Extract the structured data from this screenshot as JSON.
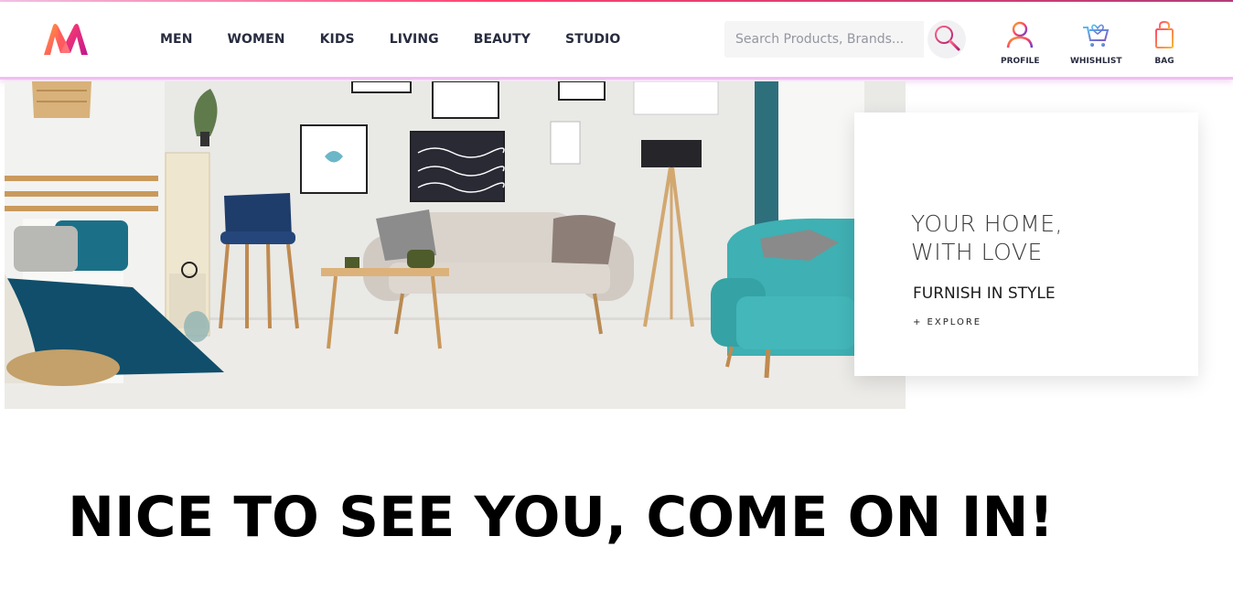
{
  "brand": {
    "logo_icon": "myntra-logo-icon",
    "accent": "#ff3f6c"
  },
  "nav": {
    "items": [
      {
        "label": "MEN"
      },
      {
        "label": "WOMEN"
      },
      {
        "label": "KIDS"
      },
      {
        "label": "LIVING"
      },
      {
        "label": "BEAUTY"
      },
      {
        "label": "STUDIO"
      }
    ]
  },
  "search": {
    "placeholder": "Search Products, Brands...",
    "value": "",
    "icon": "search-icon"
  },
  "actions": {
    "profile": {
      "label": "PROFILE",
      "icon": "profile-icon"
    },
    "wishlist": {
      "label": "WHISHLIST",
      "icon": "wishlist-icon"
    },
    "bag": {
      "label": "BAG",
      "icon": "bag-icon"
    }
  },
  "hero": {
    "title": "YOUR HOME,\nWITH LOVE",
    "subtitle": "FURNISH IN STYLE",
    "link": "+ EXPLORE"
  },
  "welcome": {
    "heading": "NICE TO SEE YOU, COME ON IN!"
  }
}
